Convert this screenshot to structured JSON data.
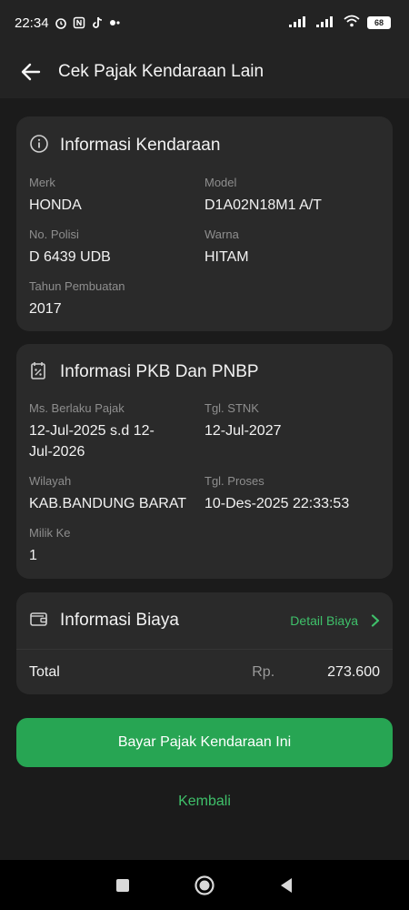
{
  "status_bar": {
    "time": "22:34",
    "battery": "68"
  },
  "header": {
    "title": "Cek Pajak Kendaraan Lain"
  },
  "vehicle_info": {
    "title": "Informasi Kendaraan",
    "fields": [
      {
        "label": "Merk",
        "value": "HONDA"
      },
      {
        "label": "Model",
        "value": "D1A02N18M1 A/T"
      },
      {
        "label": "No. Polisi",
        "value": "D 6439 UDB"
      },
      {
        "label": "Warna",
        "value": "HITAM"
      },
      {
        "label": "Tahun Pembuatan",
        "value": "2017"
      }
    ]
  },
  "pkb_info": {
    "title": "Informasi PKB Dan PNBP",
    "fields": [
      {
        "label": "Ms. Berlaku Pajak",
        "value_line1": "12-Jul-2025 s.d 12-",
        "value_line2": "Jul-2026"
      },
      {
        "label": "Tgl. STNK",
        "value": "12-Jul-2027"
      },
      {
        "label": "Wilayah",
        "value": "KAB.BANDUNG BARAT"
      },
      {
        "label": "Tgl. Proses",
        "value": "10-Des-2025 22:33:53"
      },
      {
        "label": "Milik Ke",
        "value": "1"
      }
    ]
  },
  "cost_info": {
    "title": "Informasi Biaya",
    "detail_link": "Detail Biaya",
    "total_label": "Total",
    "currency": "Rp.",
    "total_value": "273.600"
  },
  "actions": {
    "pay_button": "Bayar Pajak Kendaraan Ini",
    "back_link": "Kembali"
  },
  "colors": {
    "accent": "#27a553",
    "link": "#3fc06a",
    "card": "#2a2a2a",
    "background": "#1b1b1b"
  }
}
